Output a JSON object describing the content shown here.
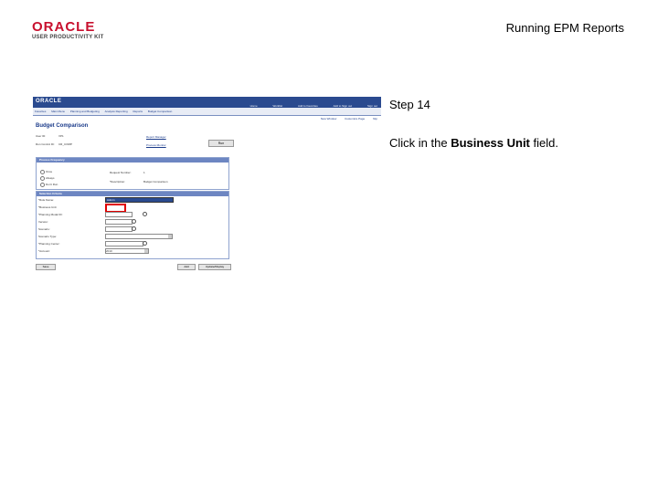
{
  "header": {
    "logo_main": "ORACLE",
    "logo_sub": "USER PRODUCTIVITY KIT",
    "doc_title": "Running EPM Reports"
  },
  "step": {
    "label": "Step 14",
    "instruction_prefix": "Click in the ",
    "instruction_bold": "Business Unit",
    "instruction_suffix": " field."
  },
  "screenshot": {
    "brand": "ORACLE",
    "top_links": [
      "Home",
      "Worklist",
      "Add to Favorites",
      "Add to Sign out",
      "Sign out"
    ],
    "menu": [
      "Favorites",
      "Main Menu",
      "Planning and Budgeting",
      "Analysis Reporting",
      "Reports",
      "Budget Comparison"
    ],
    "tools": [
      "New Window",
      "Customize Page",
      "http"
    ],
    "page_title": "Budget Comparison",
    "user_id_label": "User ID:",
    "user_id_value": "VP1",
    "run_control_label": "Run Control ID:",
    "run_control_value": "CR_COMP",
    "report_manager": "Report Manager",
    "process_monitor": "Process Monitor",
    "run_button": "Run",
    "process_box_title": "Process Frequency",
    "radios": [
      "Once",
      "Always",
      "Don't Run"
    ],
    "request_label": "Request Number:",
    "request_value": "1",
    "description_label": "*Description:",
    "description_value": "Budget Comparison",
    "criteria_box_title": "Selection Criteria",
    "fields": [
      "*Role Name:",
      "*Business Unit:",
      "*Planning Model ID:",
      "Version:",
      "Scenario:",
      "Scenario Type:",
      "*Planning Center:",
      "*Account:"
    ],
    "role_value": "Admin",
    "scenario_type_value": "",
    "account_value": "2010",
    "save_button": "Save",
    "notify_button": "Notify",
    "add_button": "Add",
    "update_button": "Update/Display"
  }
}
